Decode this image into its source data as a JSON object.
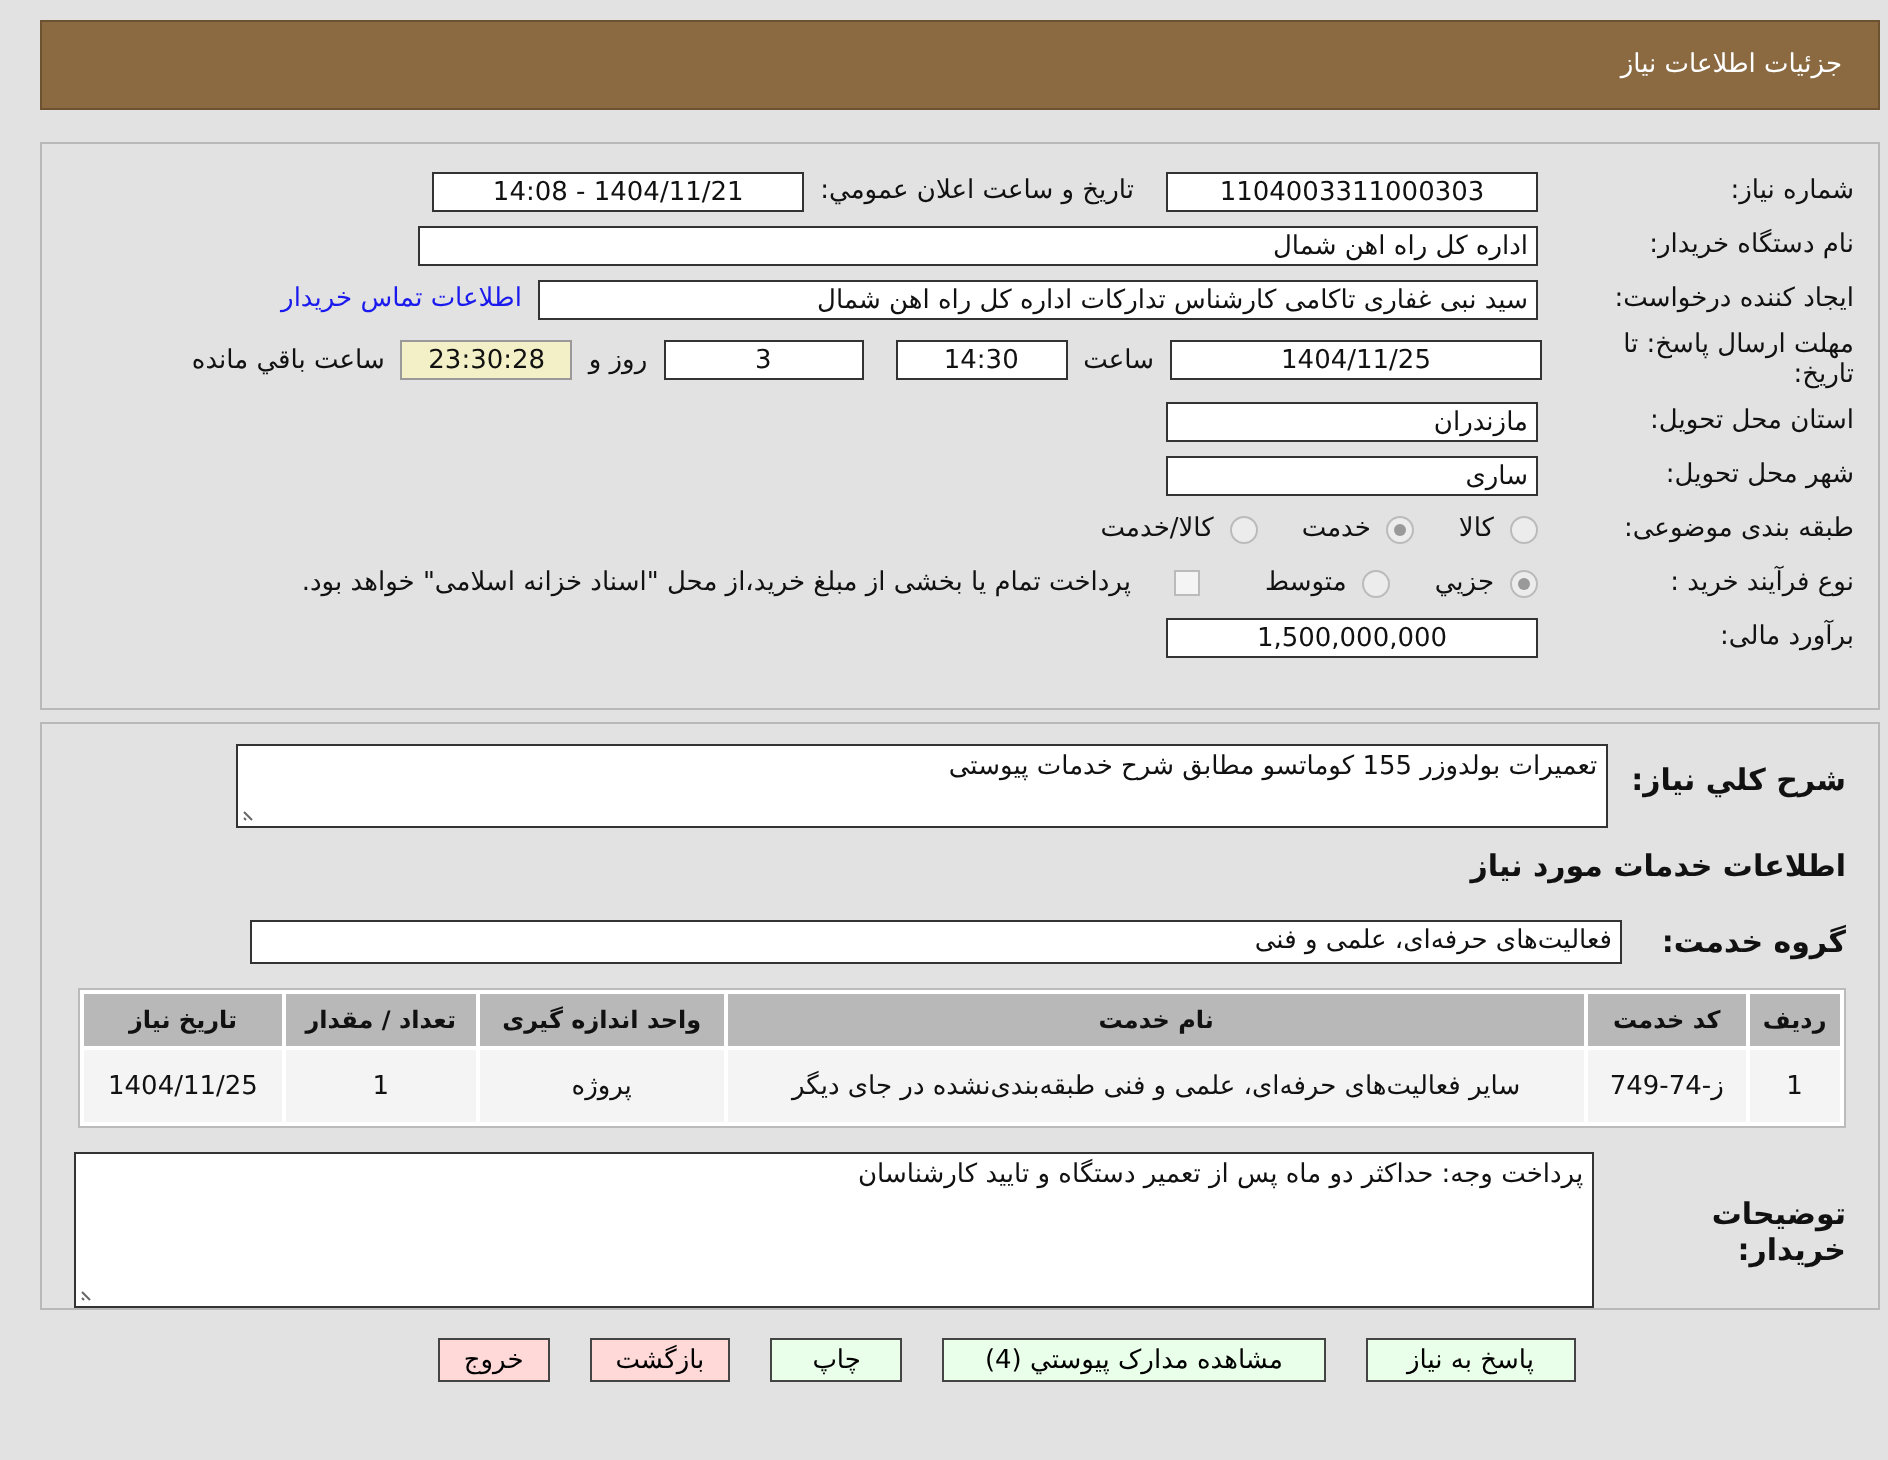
{
  "header": {
    "title": "جزئیات اطلاعات نیاز"
  },
  "need_number": {
    "label": "شماره نیاز:",
    "value": "1104003311000303"
  },
  "announce": {
    "label": "تاریخ و ساعت اعلان عمومي:",
    "value": "1404/11/21 - 14:08"
  },
  "buyer_org": {
    "label": "نام دستگاه خریدار:",
    "value": "اداره کل راه اهن شمال"
  },
  "requester": {
    "label": "ایجاد کننده درخواست:",
    "value": "سید نبی غفاری تاکامی کارشناس تدارکات اداره کل راه اهن شمال",
    "link": "اطلاعات تماس خریدار"
  },
  "deadline": {
    "label": "مهلت ارسال پاسخ: تا تاریخ:",
    "date": "1404/11/25",
    "time_label": "ساعت",
    "time": "14:30",
    "days": "3",
    "days_label": "روز و",
    "remaining": "23:30:28",
    "remaining_label": "ساعت باقي مانده"
  },
  "province": {
    "label": "استان محل تحویل:",
    "value": "مازندران"
  },
  "city": {
    "label": "شهر محل تحویل:",
    "value": "ساری"
  },
  "category": {
    "label": "طبقه بندی موضوعی:",
    "options": [
      {
        "label": "کالا",
        "selected": false
      },
      {
        "label": "خدمت",
        "selected": true
      },
      {
        "label": "کالا/خدمت",
        "selected": false
      }
    ]
  },
  "purchase_type": {
    "label": "نوع فرآیند خرید :",
    "options": [
      {
        "label": "جزيي",
        "selected": true
      },
      {
        "label": "متوسط",
        "selected": false
      }
    ],
    "treasury": {
      "checked": false,
      "text": "پرداخت تمام یا بخشی از مبلغ خرید،از محل \"اسناد خزانه اسلامی\" خواهد بود."
    }
  },
  "budget": {
    "label": "برآورد مالی:",
    "value": "1,500,000,000"
  },
  "description": {
    "label": "شرح کلي نیاز:",
    "value": "تعمیرات بولدوزر 155 کوماتسو مطابق شرح خدمات پیوستی"
  },
  "services_title": "اطلاعات خدمات مورد نیاز",
  "service_group": {
    "label": "گروه خدمت:",
    "value": "فعالیت‌های حرفه‌ای، علمی و فنی"
  },
  "table": {
    "columns": [
      "ردیف",
      "کد خدمت",
      "نام خدمت",
      "واحد اندازه گیری",
      "تعداد / مقدار",
      "تاریخ نیاز"
    ],
    "rows": [
      [
        "1",
        "ز-74-749",
        "سایر فعالیت‌های حرفه‌ای، علمی و فنی طبقه‌بندی‌نشده در جای دیگر",
        "پروژه",
        "1",
        "1404/11/25"
      ]
    ]
  },
  "buyer_notes": {
    "label": "توضیحات خریدار:",
    "value": "پرداخت وجه: حداکثر دو ماه پس از تعمیر دستگاه و تایید کارشناسان"
  },
  "buttons": [
    {
      "label": "پاسخ به نیاز",
      "kind": "primary"
    },
    {
      "label": "مشاهده مدارک پیوستي (4)",
      "kind": "primary"
    },
    {
      "label": "چاپ",
      "kind": "primary"
    },
    {
      "label": "بازگشت",
      "kind": "danger"
    },
    {
      "label": "خروج",
      "kind": "danger"
    }
  ]
}
